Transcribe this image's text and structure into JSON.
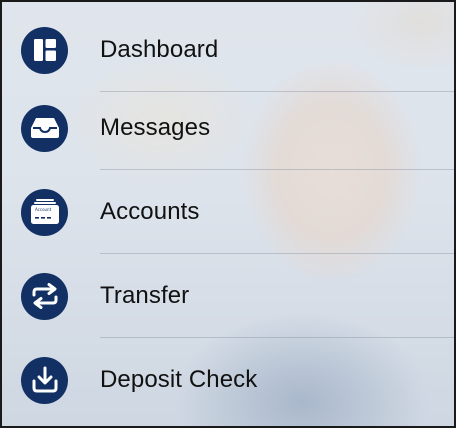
{
  "menu": {
    "items": [
      {
        "label": "Dashboard",
        "icon": "dashboard-icon"
      },
      {
        "label": "Messages",
        "icon": "inbox-tray-icon"
      },
      {
        "label": "Accounts",
        "icon": "account-card-icon",
        "icon_text": "Account"
      },
      {
        "label": "Transfer",
        "icon": "transfer-arrows-icon"
      },
      {
        "label": "Deposit Check",
        "icon": "deposit-download-icon"
      }
    ]
  },
  "colors": {
    "icon_background": "#123063",
    "label_text": "#111111",
    "divider": "#8a94a3"
  }
}
